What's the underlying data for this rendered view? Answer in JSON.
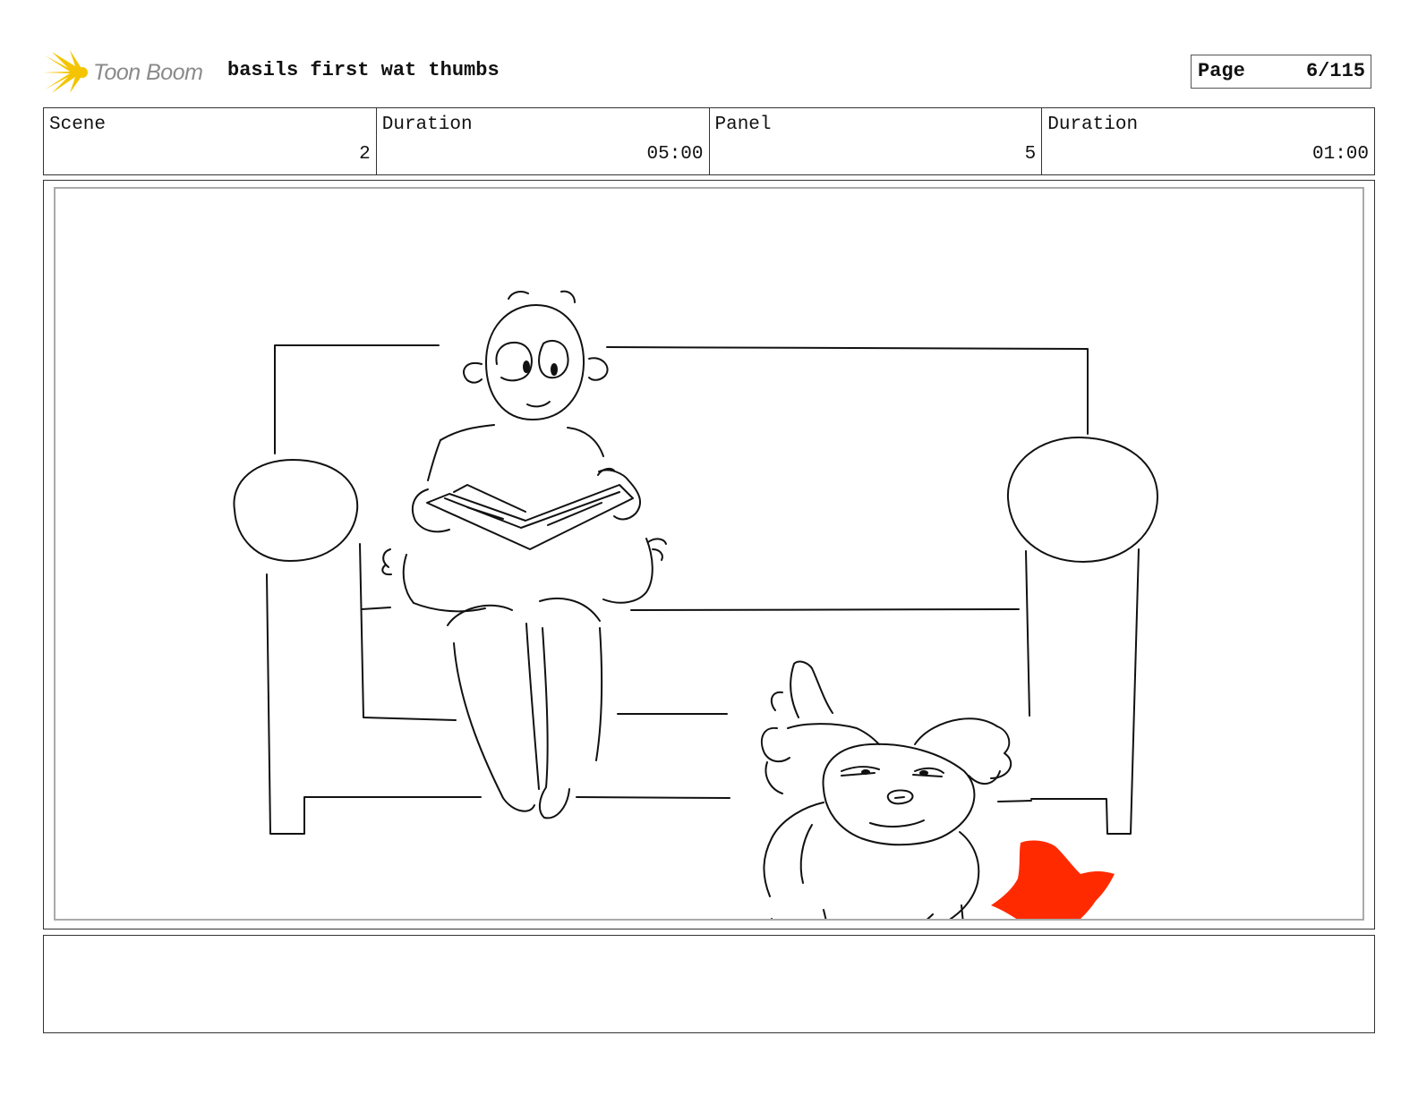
{
  "header": {
    "logo_text": "Toon Boom",
    "project_title": "basils first wat thumbs",
    "page_label": "Page",
    "page_value": "6/115"
  },
  "info": {
    "scene": {
      "label": "Scene",
      "value": "2"
    },
    "scene_duration": {
      "label": "Duration",
      "value": "05:00"
    },
    "panel": {
      "label": "Panel",
      "value": "5"
    },
    "panel_duration": {
      "label": "Duration",
      "value": "01:00"
    }
  },
  "caption": {
    "text": ""
  },
  "colors": {
    "accent_red": "#ff2a00",
    "logo_yellow": "#f5c400",
    "line": "#111111"
  },
  "icons": {
    "logo": "toon-boom-burst-icon"
  }
}
